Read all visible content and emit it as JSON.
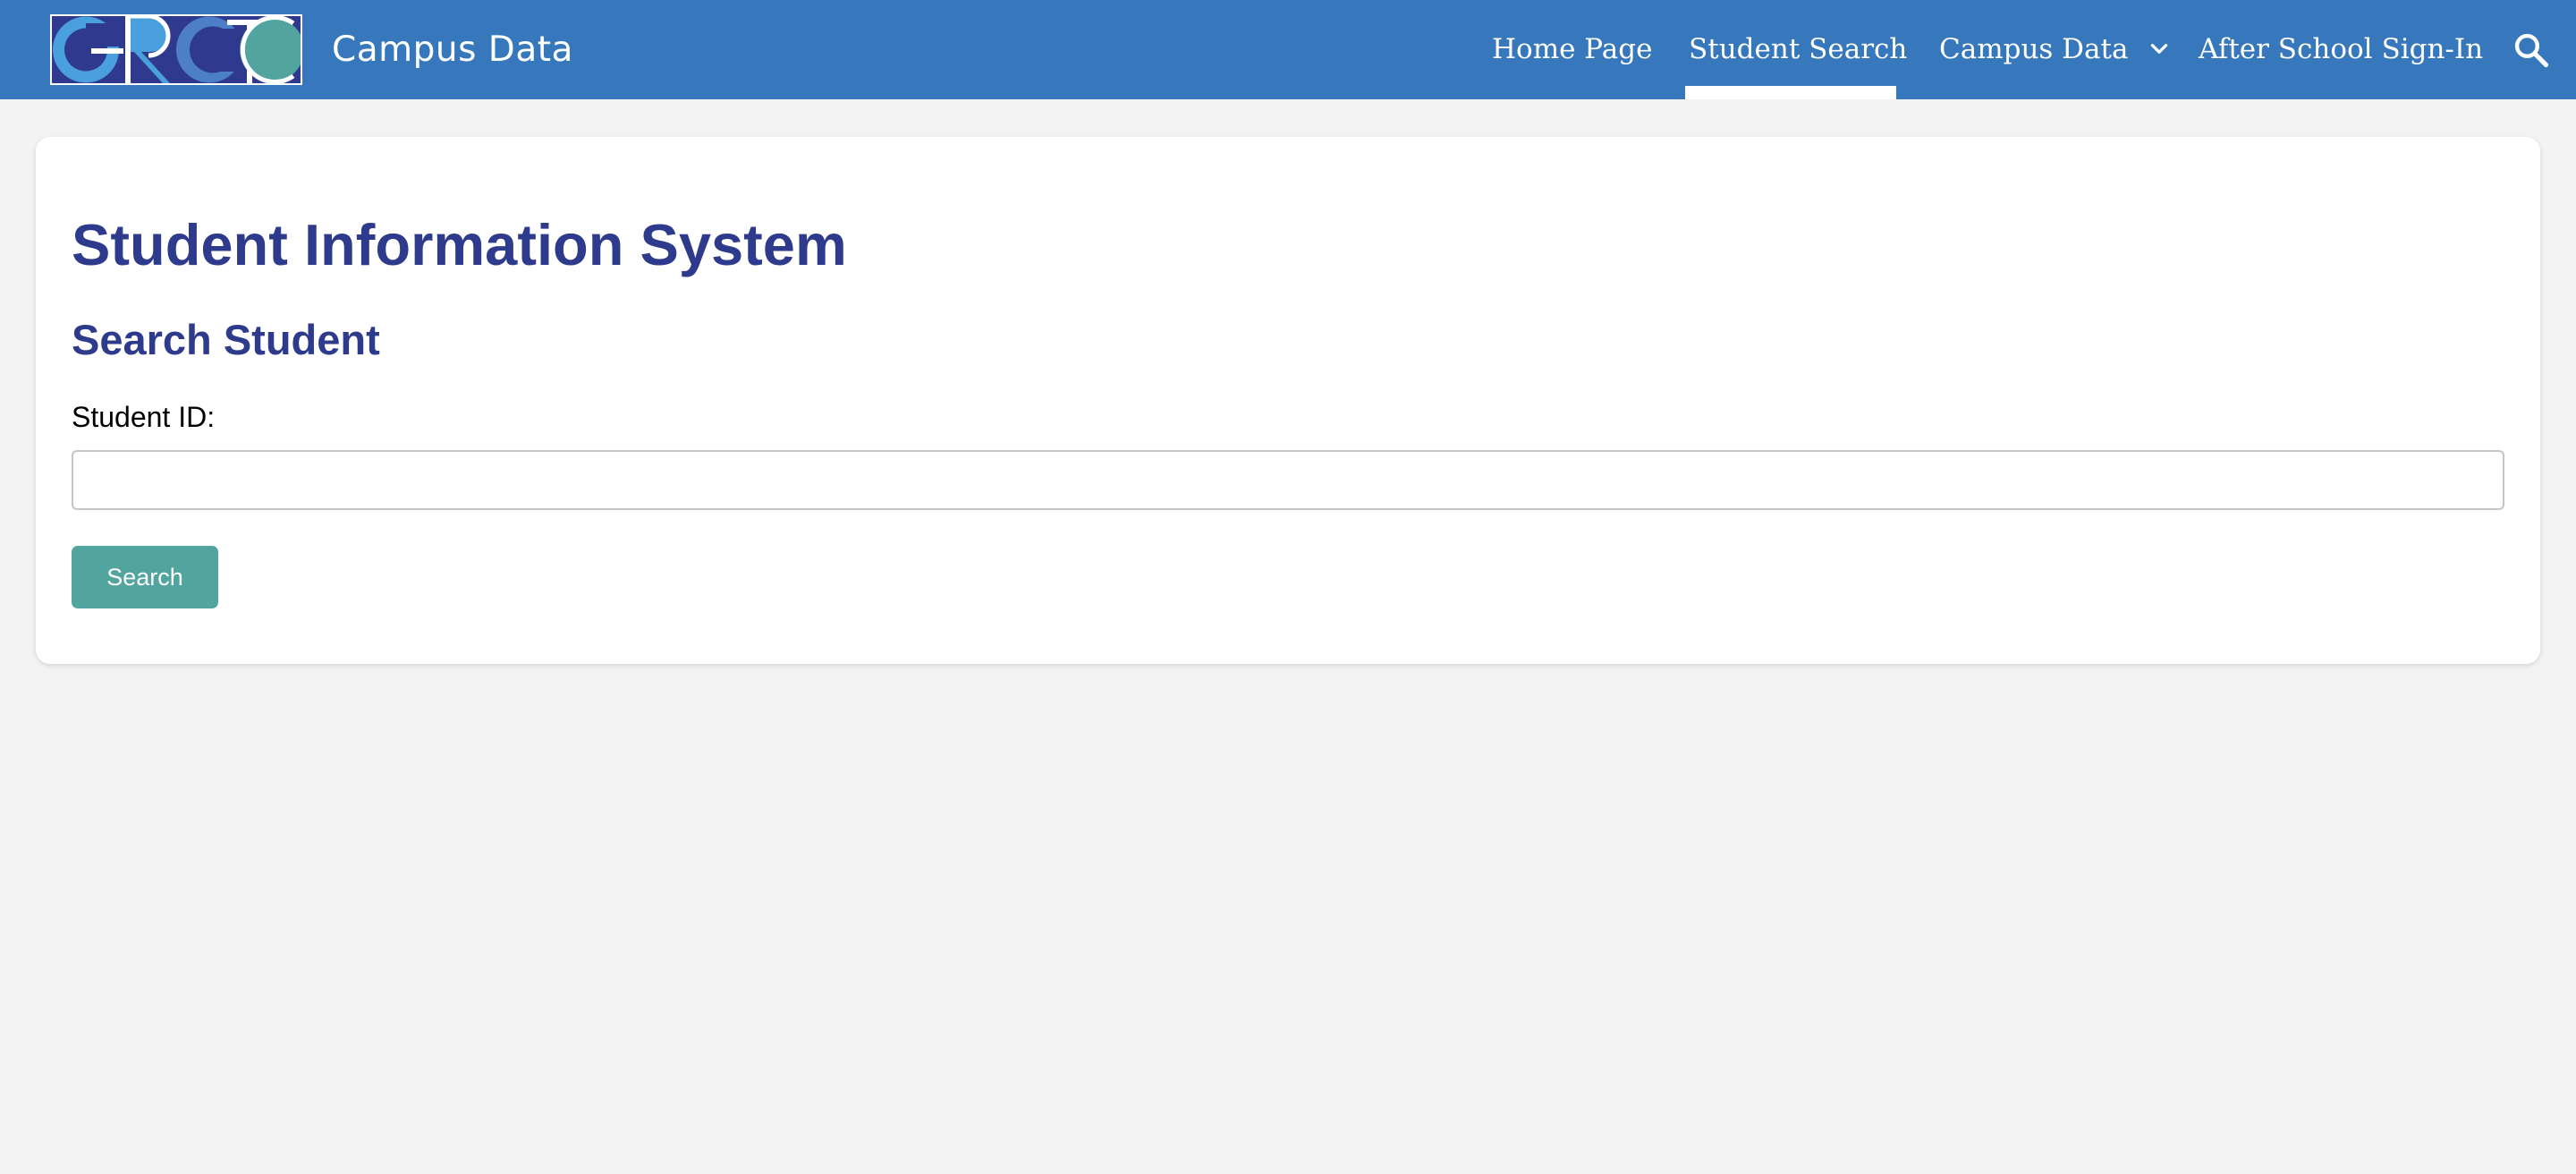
{
  "header": {
    "logo_text": "GRCTC",
    "site_title": "Campus Data",
    "nav": {
      "home": "Home Page",
      "student_search": "Student Search",
      "campus_data": "Campus Data",
      "after_school": "After School Sign-In",
      "active_item": "Student Search"
    },
    "search_icon": "search-icon",
    "dropdown_icon": "chevron-down-icon"
  },
  "main": {
    "page_title": "Student Information System",
    "section_title": "Search Student",
    "student_id_label": "Student ID:",
    "student_id_value": "",
    "search_button_label": "Search"
  },
  "colors": {
    "header_bg": "#3778bc",
    "heading": "#2e3a8c",
    "button_bg": "#52a59f",
    "page_bg": "#f3f3f3"
  }
}
